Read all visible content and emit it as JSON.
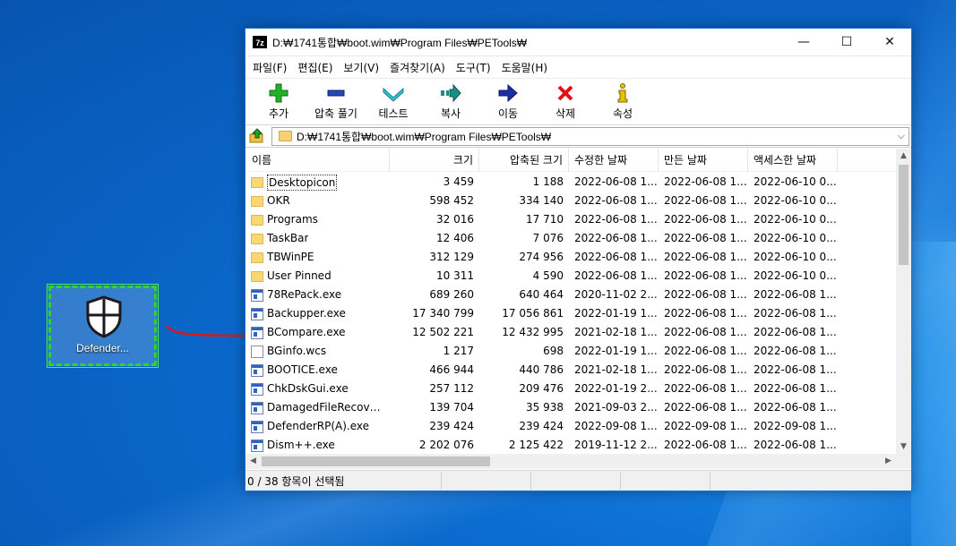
{
  "desktop": {
    "icon_label": "Defender..."
  },
  "window": {
    "app_icon_text": "7z",
    "title": "D:₩1741통합₩boot.wim₩Program Files₩PETools₩",
    "controls": {
      "minimize": "—",
      "maximize": "☐",
      "close": "✕"
    }
  },
  "menu": [
    "파일(F)",
    "편집(E)",
    "보기(V)",
    "즐겨찾기(A)",
    "도구(T)",
    "도움말(H)"
  ],
  "toolbar": [
    {
      "label": "추가",
      "icon": "plus-icon",
      "color": "#1aa51a"
    },
    {
      "label": "압축 풀기",
      "icon": "minus-icon",
      "color": "#1f3fae"
    },
    {
      "label": "테스트",
      "icon": "check-chevron-icon",
      "color": "#1fb7c9"
    },
    {
      "label": "복사",
      "icon": "copy-arrow-icon",
      "color": "#1b8f86"
    },
    {
      "label": "이동",
      "icon": "move-arrow-icon",
      "color": "#1a2fa6"
    },
    {
      "label": "삭제",
      "icon": "delete-x-icon",
      "color": "#e0121a"
    },
    {
      "label": "속성",
      "icon": "info-icon",
      "color": "#e8c200"
    }
  ],
  "address": {
    "path": "D:₩1741통합₩boot.wim₩Program Files₩PETools₩"
  },
  "columns": {
    "name": "이름",
    "size": "크기",
    "packed": "압축된 크기",
    "modified": "수정한 날짜",
    "created": "만든 날짜",
    "accessed": "액세스한 날짜"
  },
  "files": [
    {
      "type": "folder",
      "name": "Desktopicon",
      "size": "3 459",
      "packed": "1 188",
      "modified": "2022-06-08 1...",
      "created": "2022-06-08 1...",
      "accessed": "2022-06-10 0..."
    },
    {
      "type": "folder",
      "name": "OKR",
      "size": "598 452",
      "packed": "334 140",
      "modified": "2022-06-08 1...",
      "created": "2022-06-08 1...",
      "accessed": "2022-06-10 0..."
    },
    {
      "type": "folder",
      "name": "Programs",
      "size": "32 016",
      "packed": "17 710",
      "modified": "2022-06-08 1...",
      "created": "2022-06-08 1...",
      "accessed": "2022-06-10 0..."
    },
    {
      "type": "folder",
      "name": "TaskBar",
      "size": "12 406",
      "packed": "7 076",
      "modified": "2022-06-08 1...",
      "created": "2022-06-08 1...",
      "accessed": "2022-06-10 0..."
    },
    {
      "type": "folder",
      "name": "TBWinPE",
      "size": "312 129",
      "packed": "274 956",
      "modified": "2022-06-08 1...",
      "created": "2022-06-08 1...",
      "accessed": "2022-06-10 0..."
    },
    {
      "type": "folder",
      "name": "User Pinned",
      "size": "10 311",
      "packed": "4 590",
      "modified": "2022-06-08 1...",
      "created": "2022-06-08 1...",
      "accessed": "2022-06-10 0..."
    },
    {
      "type": "exe",
      "name": "78RePack.exe",
      "size": "689 260",
      "packed": "640 464",
      "modified": "2020-11-02 2...",
      "created": "2022-06-08 1...",
      "accessed": "2022-06-08 1..."
    },
    {
      "type": "exe",
      "name": "Backupper.exe",
      "size": "17 340 799",
      "packed": "17 056 861",
      "modified": "2022-01-19 1...",
      "created": "2022-06-08 1...",
      "accessed": "2022-06-08 1..."
    },
    {
      "type": "exe",
      "name": "BCompare.exe",
      "size": "12 502 221",
      "packed": "12 432 995",
      "modified": "2021-02-18 1...",
      "created": "2022-06-08 1...",
      "accessed": "2022-06-08 1..."
    },
    {
      "type": "file",
      "name": "BGinfo.wcs",
      "size": "1 217",
      "packed": "698",
      "modified": "2022-01-19 1...",
      "created": "2022-06-08 1...",
      "accessed": "2022-06-08 1..."
    },
    {
      "type": "exe",
      "name": "BOOTICE.exe",
      "size": "466 944",
      "packed": "440 786",
      "modified": "2021-02-18 1...",
      "created": "2022-06-08 1...",
      "accessed": "2022-06-08 1..."
    },
    {
      "type": "exe",
      "name": "ChkDskGui.exe",
      "size": "257 112",
      "packed": "209 476",
      "modified": "2022-01-19 2...",
      "created": "2022-06-08 1...",
      "accessed": "2022-06-08 1..."
    },
    {
      "type": "exe",
      "name": "DamagedFileRecove...",
      "size": "139 704",
      "packed": "35 938",
      "modified": "2021-09-03 2...",
      "created": "2022-06-08 1...",
      "accessed": "2022-06-08 1..."
    },
    {
      "type": "exe",
      "name": "DefenderRP(A).exe",
      "size": "239 424",
      "packed": "239 424",
      "modified": "2022-09-08 1...",
      "created": "2022-09-08 1...",
      "accessed": "2022-09-08 1..."
    },
    {
      "type": "exe",
      "name": "Dism++.exe",
      "size": "2 202 076",
      "packed": "2 125 422",
      "modified": "2019-11-12 2...",
      "created": "2022-06-08 1...",
      "accessed": "2022-06-08 1..."
    }
  ],
  "status": {
    "selection": "0 / 38 항목이 선택됨"
  }
}
